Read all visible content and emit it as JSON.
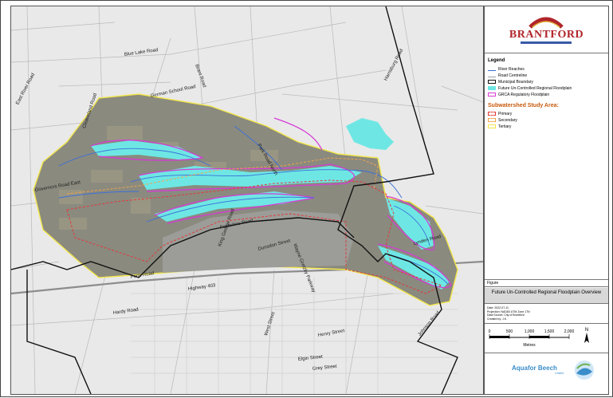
{
  "map": {
    "road_labels": [
      {
        "id": "blue-lake",
        "text": "Blue Lake Road"
      },
      {
        "id": "brant",
        "text": "Brant Road"
      },
      {
        "id": "german-school",
        "text": "German School Road"
      },
      {
        "id": "east-river",
        "text": "East River Road"
      },
      {
        "id": "harrisburg",
        "text": "Harrisburg Road"
      },
      {
        "id": "cleveland",
        "text": "Cleaveland Road"
      },
      {
        "id": "governors",
        "text": "Governors Road East"
      },
      {
        "id": "powerline",
        "text": "Powerline Road"
      },
      {
        "id": "dunsdon",
        "text": "Dunsdon Street"
      },
      {
        "id": "king-george",
        "text": "King George Road"
      },
      {
        "id": "wayne-gretzky",
        "text": "Wayne Gretzky Parkway"
      },
      {
        "id": "lynden",
        "text": "Lynden Road"
      },
      {
        "id": "paris",
        "text": "Paris Road"
      },
      {
        "id": "highway403",
        "text": "Highway 403"
      },
      {
        "id": "hardy",
        "text": "Hardy Road"
      },
      {
        "id": "west-st",
        "text": "West Street"
      },
      {
        "id": "henry",
        "text": "Henry Street"
      },
      {
        "id": "elgin",
        "text": "Elgin Street"
      },
      {
        "id": "grey",
        "text": "Grey Street"
      },
      {
        "id": "johnson",
        "text": "Johnson Road"
      },
      {
        "id": "park-rd",
        "text": "Park Road North"
      }
    ]
  },
  "logo": {
    "name": "BRANTFORD"
  },
  "legend": {
    "title": "Legend",
    "items": [
      {
        "label": "River Reaches",
        "color": "#3b6fd8"
      },
      {
        "label": "Road Centreline",
        "color": "#9aa0a6"
      },
      {
        "label": "Municipal Boundary",
        "color": "#111111"
      },
      {
        "label": "Future Un-Controlled Regional Floodplain",
        "color": "#6ee7e4"
      },
      {
        "label": "GRCA Regulatory Floodplain",
        "color": "#d63bd6"
      }
    ],
    "subwatershed_title": "Subwatershed Study Area:",
    "subwatershed_items": [
      {
        "label": "Primary",
        "color": "#e23a3a"
      },
      {
        "label": "Secondary",
        "color": "#f0a24a"
      },
      {
        "label": "Tertiary",
        "color": "#f2e64a"
      }
    ]
  },
  "figure_label": "Figure",
  "title": "Future Un-Controlled Regional Floodplain Overview",
  "meta": [
    "Date: 2022-07-11",
    "Projection: NAD83 UTM Zone 17N",
    "Data Source: City of Brantford",
    "Created by: J.K."
  ],
  "scale": {
    "ticks": [
      "0",
      "500",
      "1,000",
      "1,500",
      "2,000"
    ],
    "unit": "Metres",
    "north": "N"
  },
  "footer": {
    "company": "Aquafor Beech",
    "suffix": "Limited"
  },
  "colors": {
    "boundary": "#111111",
    "floodplain": "#6ee7e4",
    "grca": "#d63bd6",
    "primary": "#e23a3a",
    "tertiary": "#f2e64a",
    "river": "#3b6fd8",
    "aerial": "#8a8a7f"
  }
}
